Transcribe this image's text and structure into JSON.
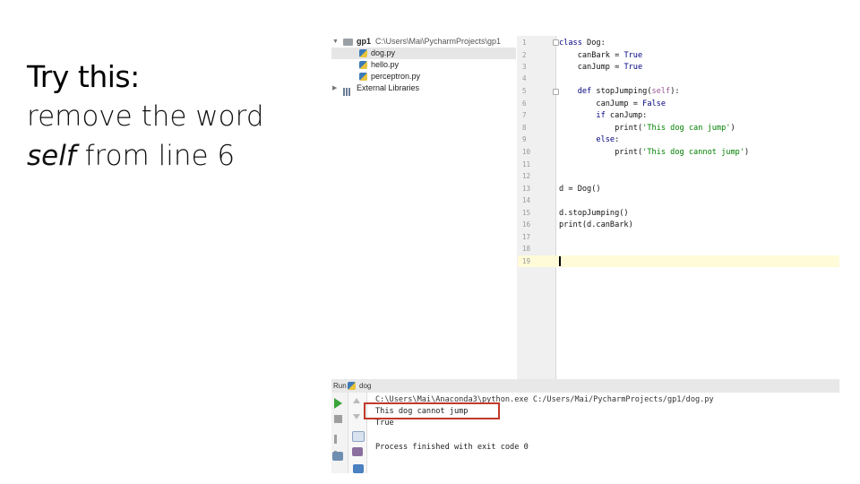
{
  "slide": {
    "title": "Try this:",
    "body_line1": "remove the word",
    "body_italic": "self",
    "body_rest": " from line 6"
  },
  "project_tree": {
    "root_name": "gp1",
    "root_path": "C:\\Users\\Mai\\PycharmProjects\\gp1",
    "files": [
      "dog.py",
      "hello.py",
      "perceptron.py"
    ],
    "selected_file": "dog.py",
    "external": "External Libraries"
  },
  "editor": {
    "line_numbers": [
      "1",
      "2",
      "3",
      "4",
      "5",
      "6",
      "7",
      "8",
      "9",
      "10",
      "11",
      "12",
      "13",
      "14",
      "15",
      "16",
      "17",
      "18",
      "19"
    ],
    "current_line": "19",
    "lines": {
      "l1_kw": "class ",
      "l1_rest": "Dog:",
      "l2_a": "    canBark = ",
      "l2_kw": "True",
      "l3_a": "    canJump = ",
      "l3_kw": "True",
      "l5_kw": "    def ",
      "l5_a": "stopJumping(",
      "l5_self": "self",
      "l5_b": "):",
      "l6_a": "        canJump = ",
      "l6_kw": "False",
      "l7_kw": "        if ",
      "l7_a": "canJump:",
      "l8_a": "            print(",
      "l8_str": "'This dog can jump'",
      "l8_b": ")",
      "l9_kw": "        else",
      "l9_a": ":",
      "l10_a": "            print(",
      "l10_str": "'This dog cannot jump'",
      "l10_b": ")",
      "l13": "d = Dog()",
      "l15": "d.stopJumping()",
      "l16": "print(d.canBark)"
    }
  },
  "run_panel": {
    "label": "Run",
    "config": "dog",
    "command": "C:\\Users\\Mai\\Anaconda3\\python.exe C:/Users/Mai/PycharmProjects/gp1/dog.py",
    "output_line1": "This dog cannot jump",
    "output_line2": "True",
    "exit_message": "Process finished with exit code 0"
  },
  "colors": {
    "keyword": "#000080",
    "string": "#008000",
    "self": "#94558d",
    "highlight_box": "#c0392b",
    "run_icon": "#3aa53a"
  }
}
